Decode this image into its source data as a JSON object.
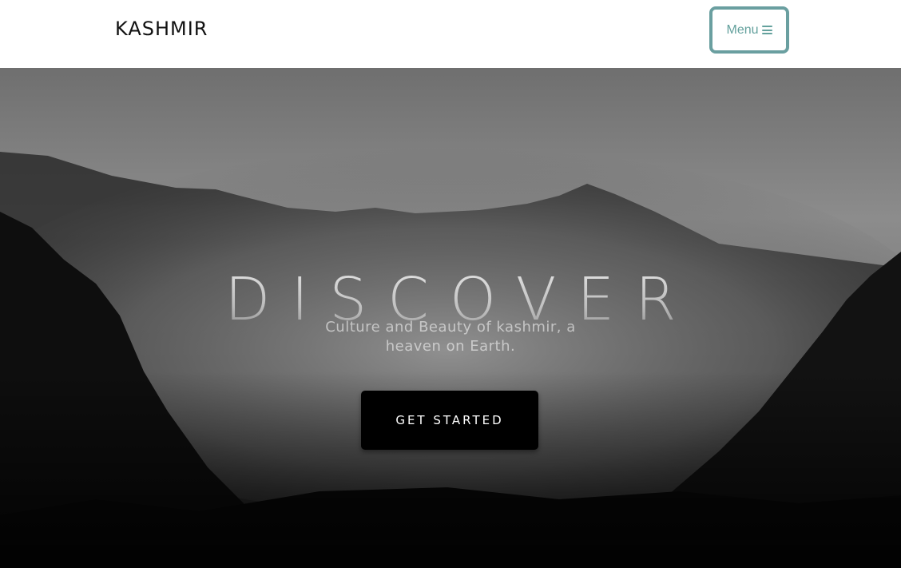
{
  "navbar": {
    "brand": "KASHMIR",
    "menu_label": "Menu",
    "menu_icon": "hamburger-icon",
    "menu_border_color": "#6a9fa0",
    "menu_text_color": "#64a19d"
  },
  "hero": {
    "title": "DISCOVER",
    "subtitle": "Culture and Beauty of kashmir, a heaven on Earth.",
    "cta_label": "GET STARTED"
  }
}
